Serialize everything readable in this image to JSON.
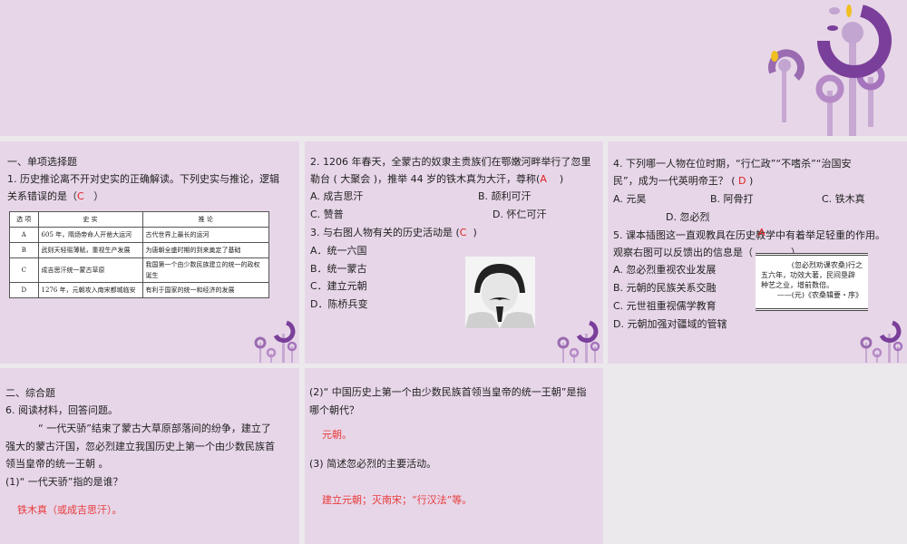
{
  "section1": {
    "title": "一、单项选择题"
  },
  "q1": {
    "line1": "1. 历史推论离不开对史实的正确解读。下列史实与推论，逻辑",
    "line2": "关系错误的是（",
    "answer": "C",
    "close": "）",
    "table": {
      "headers": [
        "选  项",
        "史  实",
        "推  论"
      ],
      "rows": [
        [
          "A",
          "605 年，隋炀帝命人开凿大运河",
          "古代世界上最长的运河"
        ],
        [
          "B",
          "武则天轻徭薄赋，重视生产发展",
          "为唐朝全盛时期的到来奠定了基础"
        ],
        [
          "C",
          "成吉思汗统一蒙古草原",
          "我国第一个由少数民族建立的统一的政权诞生"
        ],
        [
          "D",
          "1276 年，元朝攻入南宋都城临安",
          "有利于国家的统一和经济的发展"
        ]
      ]
    }
  },
  "q2": {
    "line1": "2. 1206 年春天，全蒙古的奴隶主贵族们在鄂嫩河畔举行了忽里",
    "line2": "勒台 ( 大聚会 )，推举 44 岁的铁木真为大汗，尊称(",
    "answer": "A",
    "close": ")",
    "options": [
      "A. 成吉思汗",
      "B. 颉利可汗",
      "C. 赞普",
      "D. 怀仁可汗"
    ]
  },
  "q3": {
    "stem": "3. 与右图人物有关的历史活动是 (",
    "answer": "C",
    "close": ")",
    "options": [
      "A．统一六国",
      "B．统一蒙古",
      "C．建立元朝",
      "D．陈桥兵变"
    ]
  },
  "q4": {
    "line1": "4. 下列哪一人物在位时期，“行仁政”“不嗜杀”“治国安",
    "line2": "民”，成为一代英明帝王？ (",
    "answer": "D",
    "close": ")",
    "options": [
      "A. 元昊",
      "B. 阿骨打",
      "C. 铁木真",
      "D. 忽必烈"
    ]
  },
  "q5": {
    "line1": "5. 课本插图这一直观教具在历史教学中有着举足轻重的作用。",
    "answer": "A",
    "line2": "观察右图可以反馈出的信息是（",
    "close": "）",
    "options": [
      "A. 忽必烈重视农业发展",
      "B. 元朝的民族关系交融",
      "C. 元世祖重视儒学教育",
      "D. 元朝加强对疆域的管辖"
    ],
    "quote": [
      "(忽必烈劝课农桑)行之",
      "五六年，功效大著，民间垦辟",
      "种艺之业，增前数倍。",
      "——(元)《农桑辑要・序》"
    ]
  },
  "section2": {
    "title": "二、综合题"
  },
  "q6": {
    "stem": "6. 阅读材料，回答问题。",
    "material": [
      "“ 一代天骄”结束了蒙古大草原部落间的纷争，建立了",
      "强大的蒙古汗国，忽必烈建立我国历史上第一个由少数民族首",
      "领当皇帝的统一王朝 。"
    ],
    "sub1": "(1)“ 一代天骄”指的是谁？",
    "ans1": "铁木真（或成吉思汗）。",
    "sub2": [
      "(2)“ 中国历史上第一个由少数民族首领当皇帝的统一王朝”是指",
      "哪个朝代？"
    ],
    "ans2": "元朝。",
    "sub3": "(3) 简述忽必烈的主要活动。",
    "ans3": "建立元朝；灭南宋；“行汉法”等。"
  },
  "colors": {
    "panel": "#e7d6e8",
    "accent": "#7a3f9a",
    "answer": "#e02020"
  }
}
